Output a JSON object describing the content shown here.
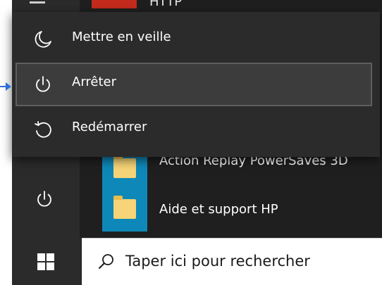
{
  "start_menu": {
    "top_partial_label": "HTTP",
    "apps": [
      {
        "label": "Action Replay PowerSaves 3D",
        "icon": "folder-icon"
      },
      {
        "label": "Aide et support HP",
        "icon": "folder-icon"
      }
    ],
    "rail_power_icon": "power-icon"
  },
  "power_menu": {
    "items": [
      {
        "label": "Mettre en veille",
        "icon": "sleep-moon-icon"
      },
      {
        "label": "Arrêter",
        "icon": "power-icon",
        "selected": true
      },
      {
        "label": "Redémarrer",
        "icon": "restart-icon"
      }
    ]
  },
  "taskbar": {
    "start_icon": "windows-logo-icon",
    "search_placeholder": "Taper ici pour rechercher"
  },
  "colors": {
    "menu_bg": "#2b2b2b",
    "tile_blue": "#0e88b8",
    "pointer_blue": "#2f6fd8"
  }
}
